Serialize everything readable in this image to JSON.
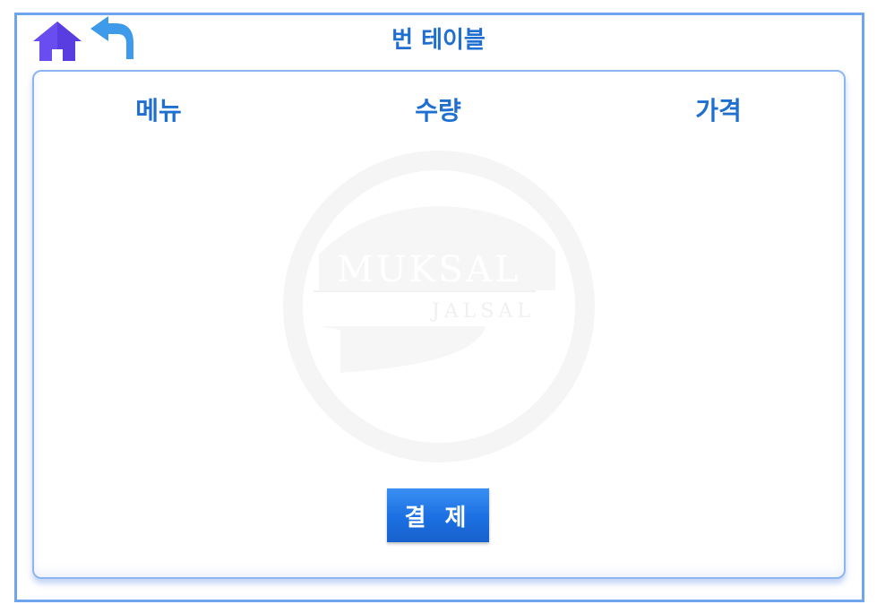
{
  "header": {
    "title": "번 테이블",
    "home_icon": "home-icon",
    "back_icon": "back-arrow-icon"
  },
  "table": {
    "columns": [
      "메뉴",
      "수량",
      "가격"
    ]
  },
  "watermark": {
    "brand": "MUKSAL",
    "sub": "JALSAL"
  },
  "actions": {
    "pay_label": "결 제"
  },
  "colors": {
    "accent": "#1f6fd0",
    "frame_border": "#6fa4ee",
    "home_icon": "#6a4df0",
    "back_icon": "#3d9be9",
    "button": "#1c6fe2"
  }
}
